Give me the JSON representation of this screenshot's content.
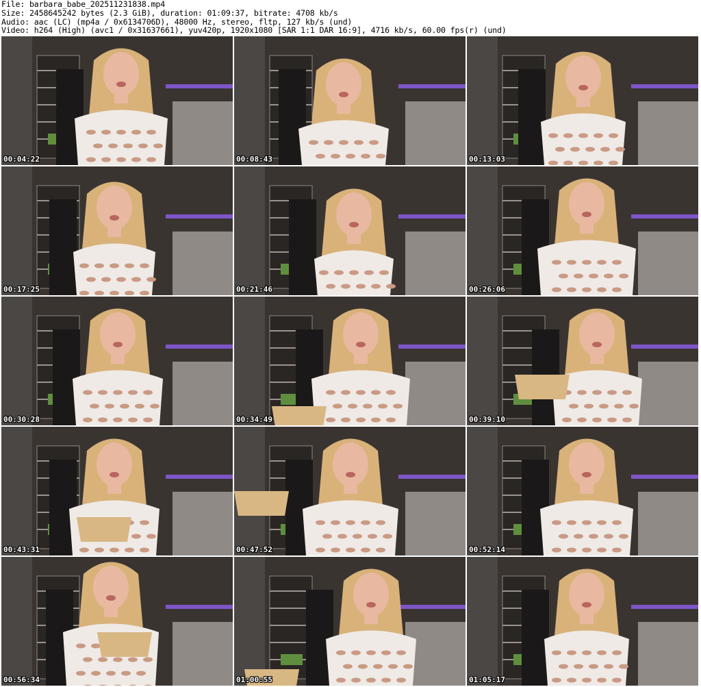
{
  "header": {
    "file": "File: barbara_babe_202511231838.mp4",
    "size": "Size: 2458645242 bytes (2.3 GiB), duration: 01:09:37, bitrate: 4708 kb/s",
    "audio": "Audio: aac (LC) (mp4a / 0x6134706D), 48000 Hz, stereo, fltp, 127 kb/s (und)",
    "video": "Video: h264 (High) (avc1 / 0x31637661), yuv420p, 1920x1080 [SAR 1:1 DAR 16:9], 4716 kb/s, 60.00 fps(r) (und)"
  },
  "frames": [
    {
      "timestamp": "00:04:22"
    },
    {
      "timestamp": "00:08:43"
    },
    {
      "timestamp": "00:13:03"
    },
    {
      "timestamp": "00:17:25"
    },
    {
      "timestamp": "00:21:46"
    },
    {
      "timestamp": "00:26:06"
    },
    {
      "timestamp": "00:30:28"
    },
    {
      "timestamp": "00:34:49"
    },
    {
      "timestamp": "00:39:10"
    },
    {
      "timestamp": "00:43:31"
    },
    {
      "timestamp": "00:47:52"
    },
    {
      "timestamp": "00:52:14"
    },
    {
      "timestamp": "00:56:34"
    },
    {
      "timestamp": "01:00:55"
    },
    {
      "timestamp": "01:05:17"
    }
  ],
  "colors": {
    "page_background": "#ffffff",
    "header_text": "#000000",
    "timestamp_text": "#ffffff",
    "room_wall": "#3a3431",
    "shirt": "#efeae6",
    "hair": "#d9b27a",
    "skin": "#e8b9a0",
    "bowl": "#d9b783"
  }
}
